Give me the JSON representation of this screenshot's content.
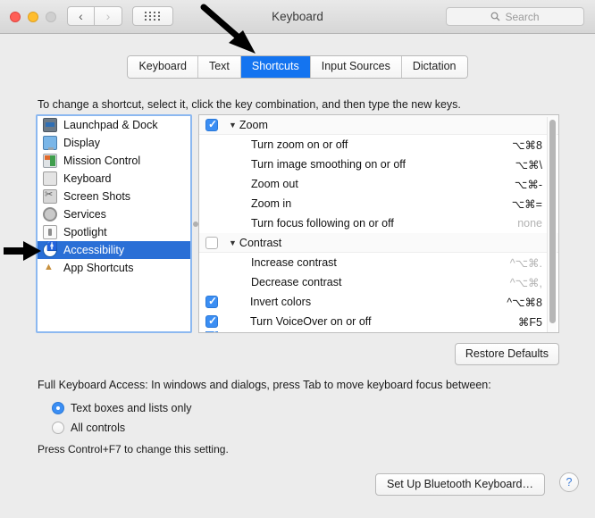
{
  "window": {
    "title": "Keyboard",
    "traffic_lights": [
      "close",
      "minimize",
      "zoom-disabled"
    ],
    "nav_back": "‹",
    "nav_forward": "›",
    "grid_button": "show-all-icon"
  },
  "search": {
    "placeholder": "Search",
    "icon": "search-icon"
  },
  "tabs": [
    {
      "label": "Keyboard",
      "active": false
    },
    {
      "label": "Text",
      "active": false
    },
    {
      "label": "Shortcuts",
      "active": true
    },
    {
      "label": "Input Sources",
      "active": false
    },
    {
      "label": "Dictation",
      "active": false
    }
  ],
  "instruction": "To change a shortcut, select it, click the key combination, and then type the new keys.",
  "sidebar": {
    "items": [
      {
        "label": "Launchpad & Dock",
        "icon": "launchpad-icon",
        "selected": false
      },
      {
        "label": "Display",
        "icon": "display-icon",
        "selected": false
      },
      {
        "label": "Mission Control",
        "icon": "mission-control-icon",
        "selected": false
      },
      {
        "label": "Keyboard",
        "icon": "keyboard-icon",
        "selected": false
      },
      {
        "label": "Screen Shots",
        "icon": "screenshots-icon",
        "selected": false
      },
      {
        "label": "Services",
        "icon": "services-gear-icon",
        "selected": false
      },
      {
        "label": "Spotlight",
        "icon": "spotlight-icon",
        "selected": false
      },
      {
        "label": "Accessibility",
        "icon": "accessibility-icon",
        "selected": true
      },
      {
        "label": "App Shortcuts",
        "icon": "app-shortcuts-icon",
        "selected": false
      }
    ]
  },
  "shortcuts": {
    "rows": [
      {
        "type": "group",
        "label": "Zoom",
        "checked": true,
        "key": ""
      },
      {
        "type": "item",
        "label": "Turn zoom on or off",
        "key": "⌥⌘8",
        "muted": false
      },
      {
        "type": "item",
        "label": "Turn image smoothing on or off",
        "key": "⌥⌘\\",
        "muted": false
      },
      {
        "type": "item",
        "label": "Zoom out",
        "key": "⌥⌘-",
        "muted": false
      },
      {
        "type": "item",
        "label": "Zoom in",
        "key": "⌥⌘=",
        "muted": false
      },
      {
        "type": "item",
        "label": "Turn focus following on or off",
        "key": "none",
        "muted": true
      },
      {
        "type": "group",
        "label": "Contrast",
        "checked": false,
        "key": ""
      },
      {
        "type": "item",
        "label": "Increase contrast",
        "key": "^⌥⌘.",
        "muted": true
      },
      {
        "type": "item",
        "label": "Decrease contrast",
        "key": "^⌥⌘,",
        "muted": true
      },
      {
        "type": "toplevel",
        "label": "Invert colors",
        "checked": true,
        "key": "^⌥⌘8",
        "muted": false
      },
      {
        "type": "toplevel",
        "label": "Turn VoiceOver on or off",
        "checked": true,
        "key": "⌘F5",
        "muted": false
      },
      {
        "type": "clipped",
        "label": "",
        "checked": true,
        "key": ""
      }
    ]
  },
  "restore_defaults_label": "Restore Defaults",
  "full_keyboard_access": {
    "label": "Full Keyboard Access: In windows and dialogs, press Tab to move keyboard focus between:",
    "options": [
      {
        "label": "Text boxes and lists only",
        "selected": true
      },
      {
        "label": "All controls",
        "selected": false
      }
    ],
    "hint": "Press Control+F7 to change this setting."
  },
  "bottom": {
    "bluetooth_label": "Set Up Bluetooth Keyboard…",
    "help_label": "?"
  },
  "annotations": [
    {
      "name": "arrow-pointing-to-shortcuts-tab",
      "direction": "down-right"
    },
    {
      "name": "arrow-pointing-to-accessibility-row",
      "direction": "right"
    }
  ],
  "colors": {
    "accent": "#1474f0",
    "selection": "#2a6fd6",
    "checkbox": "#3b8ef3"
  }
}
